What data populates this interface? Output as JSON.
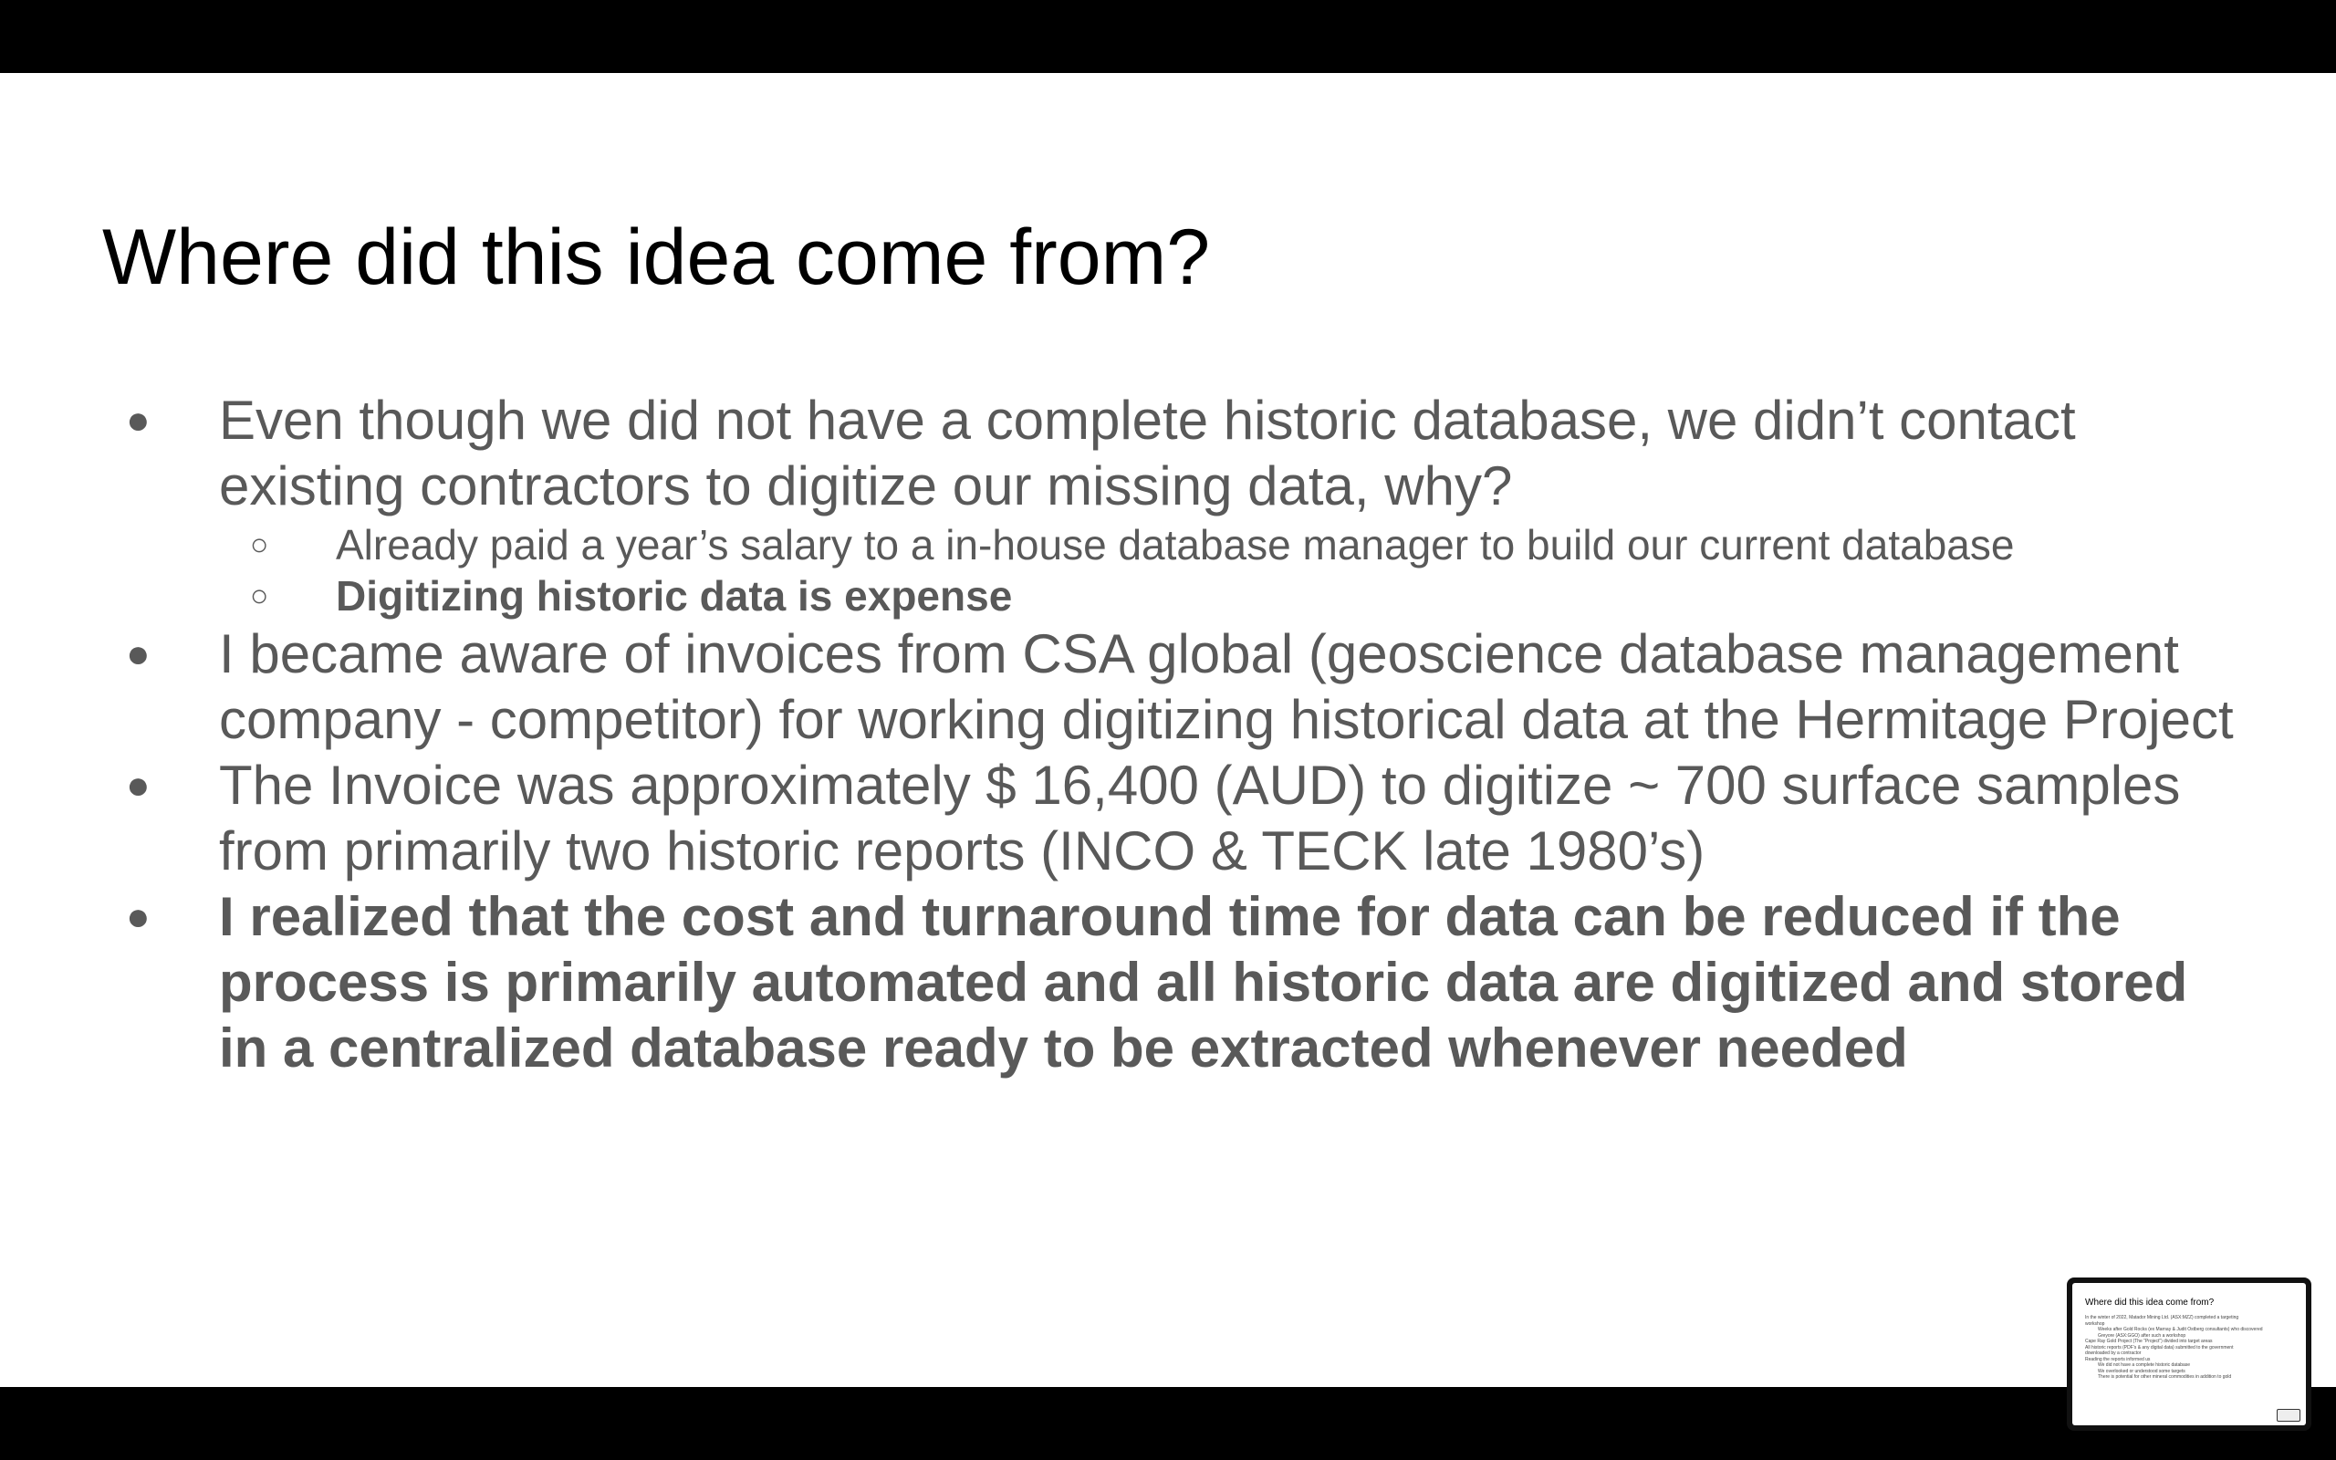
{
  "slide": {
    "title": "Where did this idea come from?",
    "bullets": [
      {
        "marker": "●",
        "text": "Even though we did not have a complete historic database, we didn’t contact existing contractors to digitize our missing data, why?",
        "bold": false,
        "sub": [
          {
            "marker": "○",
            "text": "Already paid a year’s salary to a in-house database manager to build our current database",
            "bold": false
          },
          {
            "marker": "○",
            "text": "Digitizing historic data is expense",
            "bold": true
          }
        ]
      },
      {
        "marker": "●",
        "text": "I became aware of invoices from CSA global (geoscience database management company - competitor) for working digitizing historical data at the Hermitage Project",
        "bold": false
      },
      {
        "marker": "●",
        "text": "The Invoice was approximately $ 16,400 (AUD) to digitize ~ 700 surface samples from primarily two historic reports (INCO & TECK late 1980’s)",
        "bold": false
      },
      {
        "marker": "●",
        "text": "I realized that the cost and turnaround time for data can be reduced if the process is primarily automated and all historic data are digitized and stored in a centralized database ready to be extracted whenever needed",
        "bold": true
      }
    ]
  },
  "thumbnail": {
    "title": "Where did this idea come from?",
    "lines": [
      {
        "text": "In the winter of 2022, Matador Mining Ltd. (ASX:MZZ) completed a targeting",
        "sub": false
      },
      {
        "text": "workshop",
        "sub": false
      },
      {
        "text": "Weeks after Gold Rocks (ex Marnay & Judit Ostberg consultants) who discovered",
        "sub": true
      },
      {
        "text": "Greyore (ASX:GGO) after such a workshop",
        "sub": true
      },
      {
        "text": "Cape Ray Gold Project (The “Project”) divided into target areas",
        "sub": false
      },
      {
        "text": "All historic reports (PDF’s & any digital data) submitted to the government",
        "sub": false
      },
      {
        "text": "downloaded by a contractor",
        "sub": false
      },
      {
        "text": "Reading the reports informed us",
        "sub": false
      },
      {
        "text": "We did not have a complete historic database",
        "sub": true
      },
      {
        "text": "We overlooked or understood some targets",
        "sub": true
      },
      {
        "text": "There is potential for other mineral commodities in addition to gold",
        "sub": true
      }
    ]
  },
  "colors": {
    "background": "#ffffff",
    "title": "#000000",
    "body_text": "#595959",
    "frame": "#000000"
  }
}
